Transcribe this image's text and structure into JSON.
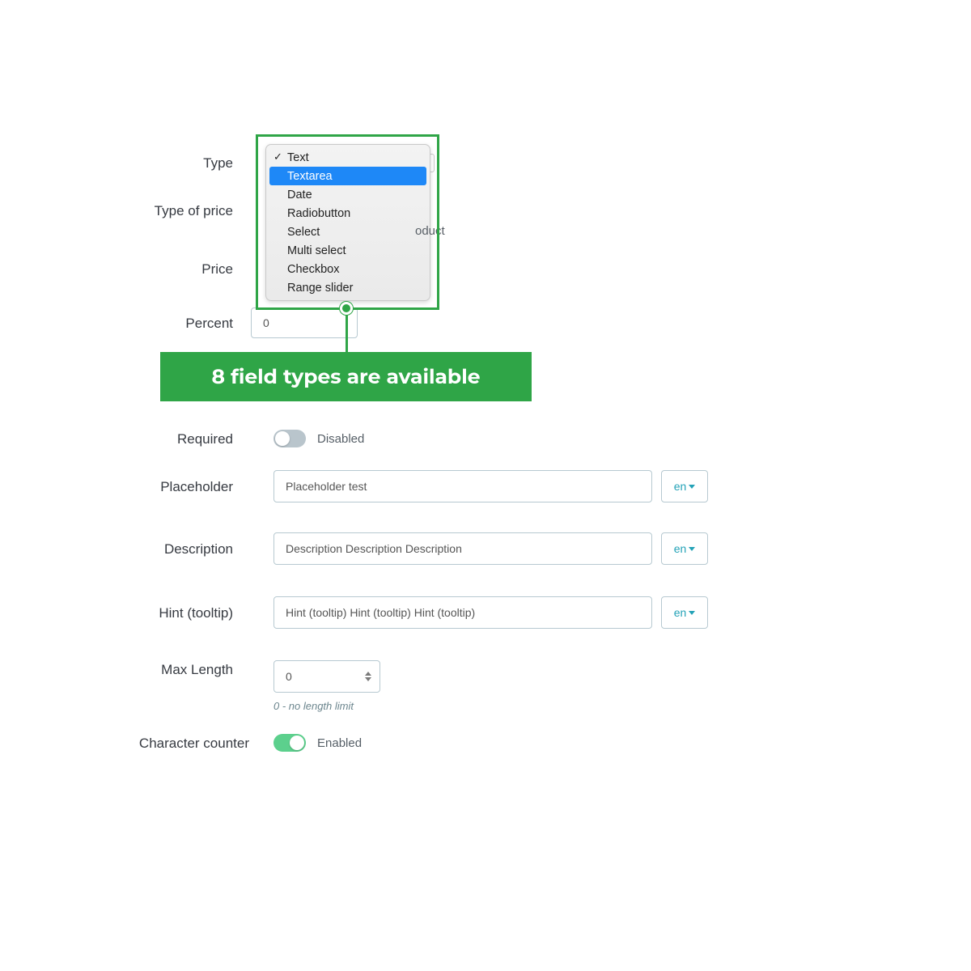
{
  "labels": {
    "type": "Type",
    "type_of_price": "Type of price",
    "price": "Price",
    "percent": "Percent",
    "required": "Required",
    "placeholder": "Placeholder",
    "description": "Description",
    "hint": "Hint (tooltip)",
    "max_length": "Max Length",
    "char_counter": "Character counter"
  },
  "dropdown": {
    "options": [
      "Text",
      "Textarea",
      "Date",
      "Radiobutton",
      "Select",
      "Multi select",
      "Checkbox",
      "Range slider"
    ],
    "selected": "Text",
    "highlighted": "Textarea"
  },
  "partial_text": "oduct",
  "percent_value": "0",
  "banner": "8 field types are available",
  "required": {
    "state": "off",
    "label": "Disabled"
  },
  "placeholder_value": "Placeholder test",
  "description_value": "Description Description Description",
  "hint_value": "Hint (tooltip) Hint (tooltip) Hint (tooltip)",
  "max_length_value": "0",
  "max_length_help": "0 - no length limit",
  "char_counter": {
    "state": "on",
    "label": "Enabled"
  },
  "lang": "en"
}
